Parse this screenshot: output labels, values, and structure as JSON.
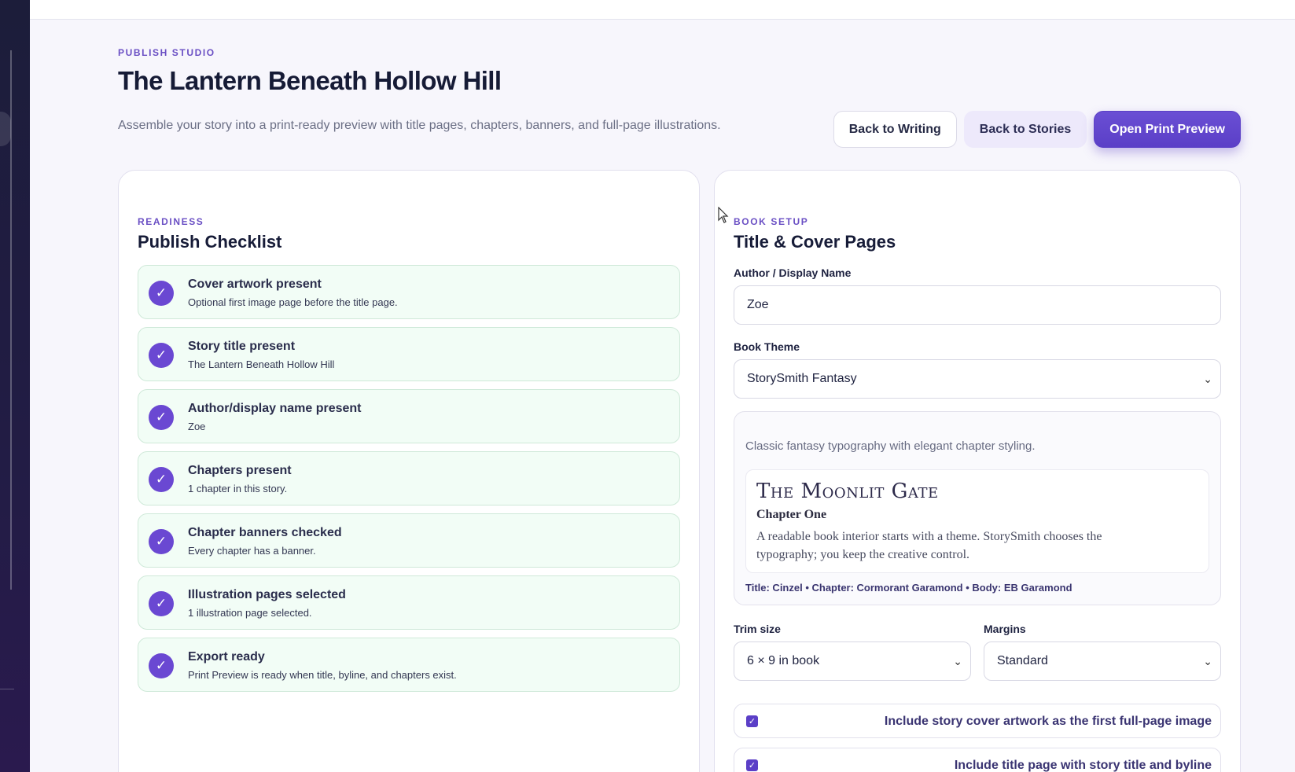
{
  "header": {
    "eyebrow": "PUBLISH STUDIO",
    "title": "The Lantern Beneath Hollow Hill",
    "subtitle": "Assemble your story into a print-ready preview with title pages, chapters, banners, and full-page illustrations.",
    "actions": {
      "back_writing": "Back to Writing",
      "back_stories": "Back to Stories",
      "print_preview": "Open Print Preview"
    }
  },
  "checklist": {
    "eyebrow": "READINESS",
    "title": "Publish Checklist",
    "check_glyph": "✓",
    "items": [
      {
        "title": "Cover artwork present",
        "desc": "Optional first image page before the title page."
      },
      {
        "title": "Story title present",
        "desc": "The Lantern Beneath Hollow Hill"
      },
      {
        "title": "Author/display name present",
        "desc": "Zoe"
      },
      {
        "title": "Chapters present",
        "desc": "1 chapter in this story."
      },
      {
        "title": "Chapter banners checked",
        "desc": "Every chapter has a banner."
      },
      {
        "title": "Illustration pages selected",
        "desc": "1 illustration page selected."
      },
      {
        "title": "Export ready",
        "desc": "Print Preview is ready when title, byline, and chapters exist."
      }
    ]
  },
  "setup": {
    "eyebrow": "BOOK SETUP",
    "title": "Title & Cover Pages",
    "author_label": "Author / Display Name",
    "author_value": "Zoe",
    "theme_label": "Book Theme",
    "theme_value": "StorySmith Fantasy",
    "theme_desc": "Classic fantasy typography with elegant chapter styling.",
    "preview": {
      "title": "The Moonlit Gate",
      "chapter": "Chapter One",
      "body": "A readable book interior starts with a theme. StorySmith chooses the typography; you keep the creative control."
    },
    "theme_fonts": "Title: Cinzel • Chapter: Cormorant Garamond • Body: EB Garamond",
    "trim_label": "Trim size",
    "trim_value": "6 × 9 in book",
    "margins_label": "Margins",
    "margins_value": "Standard",
    "chevron": "⌄",
    "toggles": [
      {
        "label": "Include story cover artwork as the first full-page image",
        "checked": true
      },
      {
        "label": "Include title page with story title and byline",
        "checked": true
      }
    ],
    "toggle_glyph": "✓"
  },
  "colors": {
    "accent": "#5b3fc7",
    "check_bg": "#f2fdf6",
    "sidebar": "#1c1d3a"
  }
}
